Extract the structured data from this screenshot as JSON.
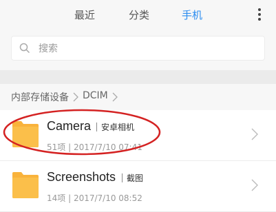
{
  "tabs": [
    {
      "label": "最近",
      "active": false
    },
    {
      "label": "分类",
      "active": false
    },
    {
      "label": "手机",
      "active": true
    }
  ],
  "menu": {
    "icon": "more-vertical-icon"
  },
  "search": {
    "placeholder": "搜索",
    "value": "",
    "icon": "search-icon"
  },
  "breadcrumb": {
    "items": [
      "内部存储设备",
      "DCIM"
    ]
  },
  "folders": [
    {
      "name": "Camera",
      "tag": "安卓相机",
      "meta": "51项 | 2017/7/10 07:41",
      "icon": "folder-icon"
    },
    {
      "name": "Screenshots",
      "tag": "截图",
      "meta": "14项 | 2017/7/10 08:52",
      "icon": "folder-icon"
    }
  ],
  "colors": {
    "accent": "#2a8cf0",
    "folder": "#f9b33c",
    "annotation": "#d42222"
  }
}
